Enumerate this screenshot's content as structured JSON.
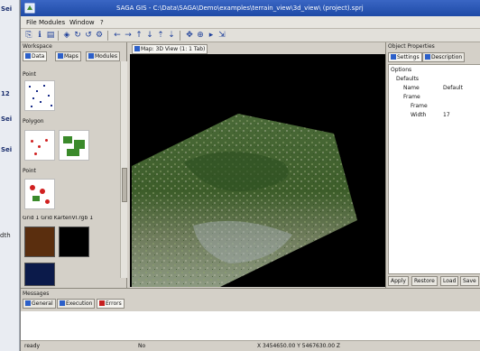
{
  "background_window": {
    "fragments": [
      "Sei",
      "12",
      "Sei",
      "Sei"
    ],
    "width_label": "dth"
  },
  "window": {
    "title": "SAGA GIS - C:\\Data\\SAGA\\Demo\\examples\\terrain_view\\3d_view\\ (project).sprj"
  },
  "menu": [
    "File",
    "Modules",
    "Window",
    "?"
  ],
  "toolbar": {
    "buttons": [
      "open-icon",
      "info-icon",
      "table-icon",
      "layer-icon",
      "arrow-left-icon",
      "arrow-right-icon",
      "arrow-up-icon",
      "arrow-down-icon",
      "zoom-in-icon",
      "zoom-out-icon",
      "pan-icon",
      "select-icon",
      "refresh-icon"
    ]
  },
  "left_dock": {
    "label": "Workspace",
    "tabs": [
      "Data",
      "Maps",
      "Modules"
    ],
    "sections": [
      "Point",
      "Polygon",
      "Point"
    ],
    "caption": "Grid  1   Grid  KartenVI.rgb 1",
    "swatch_colors": [
      "#5a2e0e",
      "#000000",
      "#0b1a4a"
    ]
  },
  "map": {
    "tab": "Map: 3D View (1: 1 Tab)"
  },
  "right_dock": {
    "label": "Object Properties",
    "tabs": [
      "Settings",
      "Description"
    ],
    "tree": [
      "Options",
      "Defaults",
      "Name",
      "Frame",
      "Frame",
      "Width"
    ],
    "values": [
      "",
      "",
      "Default",
      "",
      "",
      "17"
    ],
    "bottom_tabs": [
      "Apply",
      "Restore",
      "Load",
      "Save"
    ]
  },
  "messages": {
    "label": "Messages",
    "tabs": [
      "General",
      "Execution",
      "Errors"
    ]
  },
  "status": {
    "left": "ready",
    "mid": "No",
    "right": "X 3454650.00 Y 5467630.00 Z"
  }
}
